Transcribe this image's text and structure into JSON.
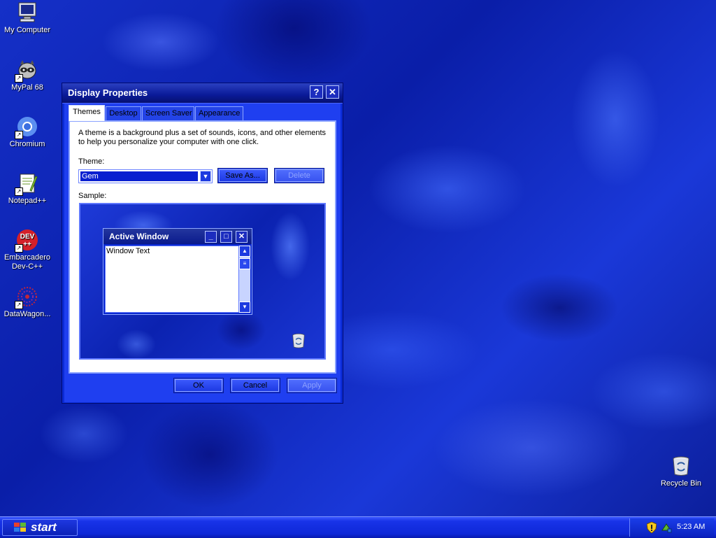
{
  "desktop": {
    "icons": [
      {
        "label": "My Computer",
        "icon": "computer-icon"
      },
      {
        "label": "MyPal 68",
        "icon": "mypal-browser-icon"
      },
      {
        "label": "Chromium",
        "icon": "chromium-icon"
      },
      {
        "label": "Notepad++",
        "icon": "notepad-plus-plus-icon"
      },
      {
        "label_line1": "Embarcadero",
        "label_line2": "Dev-C++",
        "icon": "devcpp-icon",
        "glyph_text": "DEV\n++"
      },
      {
        "label": "DataWagon...",
        "icon": "datawagon-icon"
      },
      {
        "label": "Recycle Bin",
        "icon": "recycle-bin-icon"
      }
    ]
  },
  "dialog": {
    "title": "Display Properties",
    "help_glyph": "?",
    "close_glyph": "✕",
    "tabs": [
      {
        "label": "Themes",
        "active": true
      },
      {
        "label": "Desktop"
      },
      {
        "label": "Screen Saver"
      },
      {
        "label": "Appearance"
      }
    ],
    "description": "A theme is a background plus a set of sounds, icons, and other elements to help you personalize your computer with one click.",
    "theme_label": "Theme:",
    "theme_value": "Gem",
    "save_as_label": "Save As...",
    "delete_label": "Delete",
    "sample_label": "Sample:",
    "sample": {
      "window_title": "Active Window",
      "window_text": "Window Text"
    },
    "ok_label": "OK",
    "cancel_label": "Cancel",
    "apply_label": "Apply"
  },
  "taskbar": {
    "start_label": "start",
    "clock": "5:23 AM"
  },
  "colors": {
    "desktop_blue": "#0a1ea8",
    "dialog_frame": "#0b2bd6",
    "title_bar": "#0a1a98",
    "taskbar": "#0e28d8"
  }
}
